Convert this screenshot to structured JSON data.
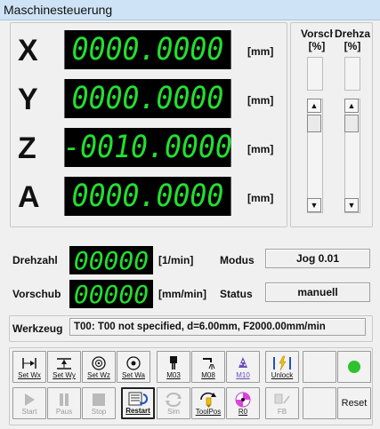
{
  "window": {
    "title": "Maschinesteuerung"
  },
  "axes": [
    {
      "letter": "X",
      "value": "0000.0000",
      "unit": "[mm]"
    },
    {
      "letter": "Y",
      "value": "0000.0000",
      "unit": "[mm]"
    },
    {
      "letter": "Z",
      "value": "-0010.0000",
      "unit": "[mm]"
    },
    {
      "letter": "A",
      "value": "0000.0000",
      "unit": "[mm]"
    }
  ],
  "overrides": {
    "feed": {
      "label": "Vorsch",
      "unit": "[%]"
    },
    "speed": {
      "label": "Drehza",
      "unit": "[%]"
    }
  },
  "spindle": {
    "label": "Drehzahl",
    "value": "00000",
    "unit": "[1/min]"
  },
  "feedrate": {
    "label": "Vorschub",
    "value": "00000",
    "unit": "[mm/min]"
  },
  "mode": {
    "label": "Modus",
    "value": "Jog 0.01"
  },
  "status": {
    "label": "Status",
    "value": "manuell"
  },
  "tool": {
    "label": "Werkzeug",
    "value": "T00: T00 not specified, d=6.00mm, F2000.00mm/min"
  },
  "toolbar_row1": [
    {
      "label": "Set Wx",
      "icon": "set-x-icon"
    },
    {
      "label": "Set Wy",
      "icon": "set-y-icon"
    },
    {
      "label": "Set Wz",
      "icon": "set-z-icon"
    },
    {
      "label": "Set Wa",
      "icon": "set-a-icon"
    },
    {
      "label": "M03",
      "icon": "spindle-icon"
    },
    {
      "label": "M08",
      "icon": "coolant-icon"
    },
    {
      "label": "M10",
      "icon": "mist-icon"
    },
    {
      "label": "Unlock",
      "icon": "unlock-icon"
    }
  ],
  "toolbar_row2": [
    {
      "label": "Start",
      "icon": "play-icon"
    },
    {
      "label": "Paus",
      "icon": "pause-icon"
    },
    {
      "label": "Stop",
      "icon": "stop-icon"
    },
    {
      "label": "Restart",
      "icon": "restart-icon"
    },
    {
      "label": "Sim",
      "icon": "sim-icon"
    },
    {
      "label": "ToolPos",
      "icon": "toolpos-icon"
    },
    {
      "label": "R0",
      "icon": "reference-icon"
    },
    {
      "label": "FB",
      "icon": "fb-icon"
    }
  ],
  "reset": {
    "label": "Reset"
  },
  "indicator": {
    "color": "#2ec22e"
  }
}
